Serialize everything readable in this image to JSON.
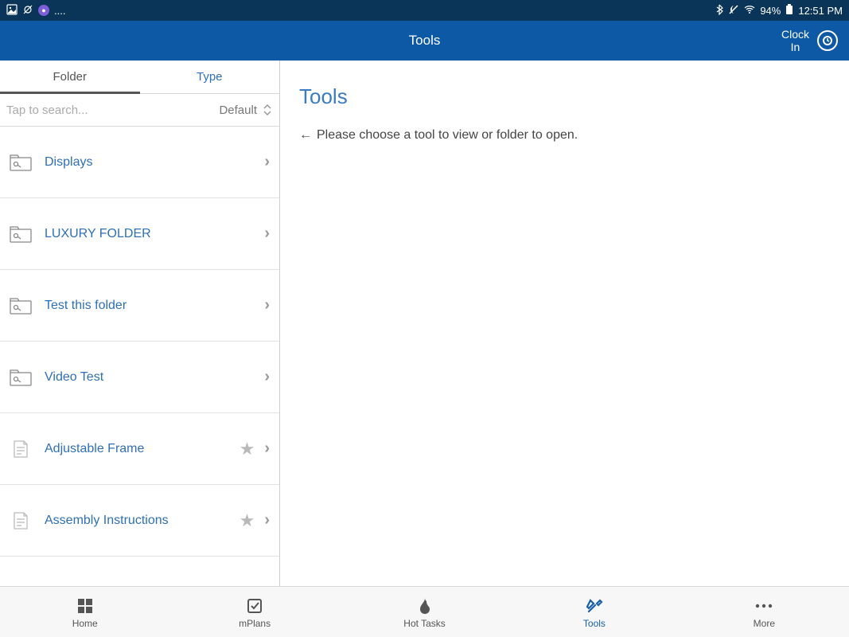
{
  "status": {
    "right_text": "94%",
    "time": "12:51 PM",
    "dots": "...."
  },
  "header": {
    "title": "Tools",
    "clock_in": "Clock\nIn"
  },
  "left": {
    "tabs": {
      "folder": "Folder",
      "type": "Type"
    },
    "search_placeholder": "Tap to search...",
    "sort_label": "Default",
    "items": [
      {
        "label": "Displays",
        "kind": "folder",
        "starred": false
      },
      {
        "label": "LUXURY FOLDER",
        "kind": "folder",
        "starred": false
      },
      {
        "label": "Test this folder",
        "kind": "folder",
        "starred": false
      },
      {
        "label": "Video Test",
        "kind": "folder",
        "starred": false
      },
      {
        "label": "Adjustable Frame",
        "kind": "doc",
        "starred": true
      },
      {
        "label": "Assembly Instructions",
        "kind": "doc",
        "starred": true
      }
    ]
  },
  "right": {
    "title": "Tools",
    "prompt": "Please choose a tool to view or folder to open."
  },
  "nav": {
    "home": "Home",
    "mplans": "mPlans",
    "hot_tasks": "Hot Tasks",
    "tools": "Tools",
    "more": "More"
  }
}
